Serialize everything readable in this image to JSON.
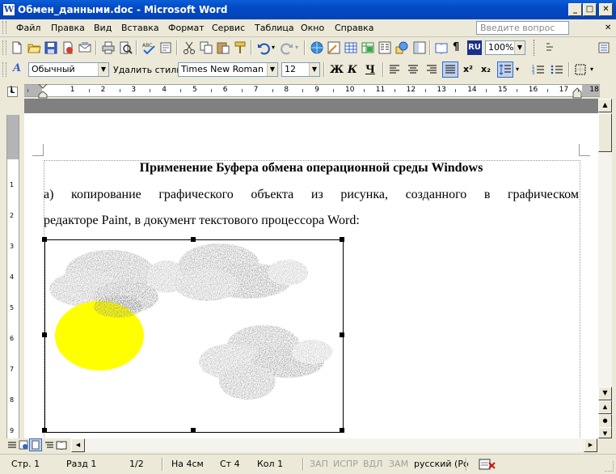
{
  "window": {
    "title": "Обмен_данными.doc - Microsoft Word",
    "icon_letter": "W",
    "buttons": {
      "minimize": "_",
      "maximize": "□",
      "close": "✕"
    }
  },
  "menu": {
    "items": [
      "Файл",
      "Правка",
      "Вид",
      "Вставка",
      "Формат",
      "Сервис",
      "Таблица",
      "Окно",
      "Справка"
    ],
    "help_placeholder": "Введите вопрос",
    "close_doc": "✕"
  },
  "standard_toolbar": {
    "language": "RU",
    "zoom": "100%",
    "pilcrow": "¶"
  },
  "formatting_toolbar": {
    "style": "Обычный",
    "clear_style": "Удалить стиль",
    "font": "Times New Roman",
    "size": "12",
    "bold": "Ж",
    "italic": "К",
    "underline": "Ч",
    "superscript": "x²",
    "subscript": "x₂"
  },
  "ruler": {
    "numbers": [
      "1",
      "1",
      "2",
      "3",
      "4",
      "5",
      "6",
      "7",
      "8",
      "9",
      "10",
      "11",
      "12",
      "13",
      "14",
      "15",
      "16",
      "17",
      "18"
    ]
  },
  "document": {
    "heading": "Применение Буфера обмена операционной среды Windows",
    "para_line1": "а) копирование графического объекта из рисунка, созданного в графическом",
    "para_line2": "редакторе Paint, в документ текстового процессора Word:",
    "image": {
      "sun_color": "#ffff00",
      "cloud_color": "#8c8c8c"
    }
  },
  "status": {
    "page": "Стр. 1",
    "section": "Разд  1",
    "pages": "1/2",
    "at": "На 4см",
    "line": "Ст  4",
    "col": "Кол  1",
    "rec": "ЗАП",
    "trk": "ИСПР",
    "ext": "ВДЛ",
    "ovr": "ЗАМ",
    "language": "русский (Ро"
  }
}
